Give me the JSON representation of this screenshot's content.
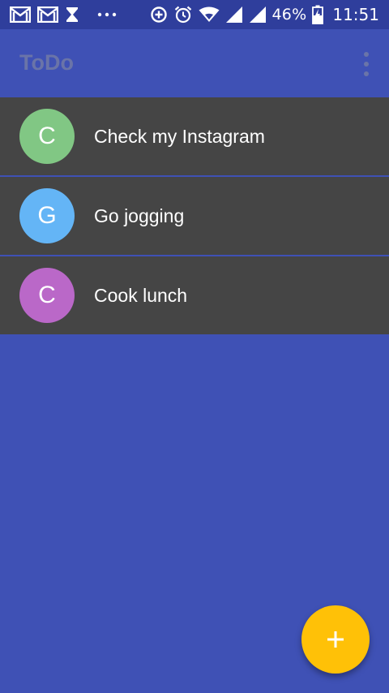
{
  "status_bar": {
    "left_icons": [
      "gmail-icon",
      "gmail-icon",
      "hourglass-icon",
      "more-notifications-icon"
    ],
    "right_icons": [
      "data-saver-icon",
      "alarm-icon",
      "wifi-icon",
      "signal-icon",
      "signal-icon",
      "battery-charging-icon"
    ],
    "battery_percent": "46%",
    "time": "11:51"
  },
  "app_bar": {
    "title": "ToDo",
    "menu_icon": "more-vert-icon"
  },
  "todos": [
    {
      "initial": "C",
      "text": "Check my Instagram",
      "avatar_color": "#81c784"
    },
    {
      "initial": "G",
      "text": "Go jogging",
      "avatar_color": "#64b5f6"
    },
    {
      "initial": "C",
      "text": "Cook lunch",
      "avatar_color": "#ba68c8"
    }
  ],
  "fab": {
    "icon": "plus-icon",
    "color": "#ffc107"
  },
  "colors": {
    "primary": "#3f51b5",
    "status_bar": "#2f3e9c",
    "list_item_bg": "#454545",
    "title_text": "#6a74a8"
  }
}
